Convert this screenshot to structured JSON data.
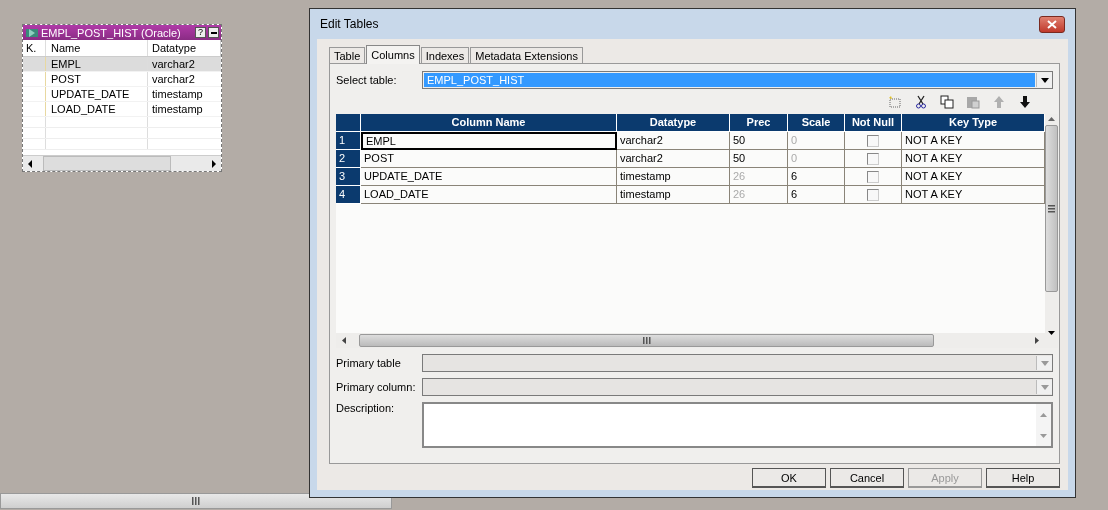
{
  "source_table": {
    "title": "EMPL_POST_HIST (Oracle)",
    "help": "?",
    "columns": [
      "K.",
      "Name",
      "Datatype"
    ],
    "rows": [
      {
        "name": "EMPL",
        "datatype": "varchar2",
        "selected": true
      },
      {
        "name": "POST",
        "datatype": "varchar2",
        "selected": false
      },
      {
        "name": "UPDATE_DATE",
        "datatype": "timestamp",
        "selected": false
      },
      {
        "name": "LOAD_DATE",
        "datatype": "timestamp",
        "selected": false
      }
    ]
  },
  "dialog": {
    "title": "Edit Tables",
    "tabs": [
      {
        "label": "Table",
        "selected": false
      },
      {
        "label": "Columns",
        "selected": true
      },
      {
        "label": "Indexes",
        "selected": false
      },
      {
        "label": "Metadata Extensions",
        "selected": false
      }
    ],
    "select_table": {
      "label": "Select table:",
      "value": "EMPL_POST_HIST"
    },
    "toolbar": [
      {
        "kind": "new",
        "disabled": false
      },
      {
        "kind": "cut",
        "disabled": false
      },
      {
        "kind": "copy",
        "disabled": false
      },
      {
        "kind": "paste",
        "disabled": true
      },
      {
        "kind": "up",
        "disabled": true
      },
      {
        "kind": "down",
        "disabled": false
      }
    ],
    "grid": {
      "columns": [
        "Column Name",
        "Datatype",
        "Prec",
        "Scale",
        "Not Null",
        "Key Type"
      ],
      "rows": [
        {
          "num": "1",
          "name": "EMPL",
          "datatype": "varchar2",
          "prec": "50",
          "prec_disabled": false,
          "scale": "0",
          "scale_disabled": true,
          "not_null": false,
          "key_type": "NOT A KEY",
          "selected": true
        },
        {
          "num": "2",
          "name": "POST",
          "datatype": "varchar2",
          "prec": "50",
          "prec_disabled": false,
          "scale": "0",
          "scale_disabled": true,
          "not_null": false,
          "key_type": "NOT A KEY",
          "selected": false
        },
        {
          "num": "3",
          "name": "UPDATE_DATE",
          "datatype": "timestamp",
          "prec": "26",
          "prec_disabled": true,
          "scale": "6",
          "scale_disabled": false,
          "not_null": false,
          "key_type": "NOT A KEY",
          "selected": false
        },
        {
          "num": "4",
          "name": "LOAD_DATE",
          "datatype": "timestamp",
          "prec": "26",
          "prec_disabled": true,
          "scale": "6",
          "scale_disabled": false,
          "not_null": false,
          "key_type": "NOT A KEY",
          "selected": false
        }
      ]
    },
    "primary_table": {
      "label": "Primary table"
    },
    "primary_column": {
      "label": "Primary column:"
    },
    "description": {
      "label": "Description:"
    },
    "buttons": [
      {
        "label": "OK",
        "disabled": false
      },
      {
        "label": "Cancel",
        "disabled": false
      },
      {
        "label": "Apply",
        "disabled": true
      },
      {
        "label": "Help",
        "disabled": false
      }
    ]
  }
}
